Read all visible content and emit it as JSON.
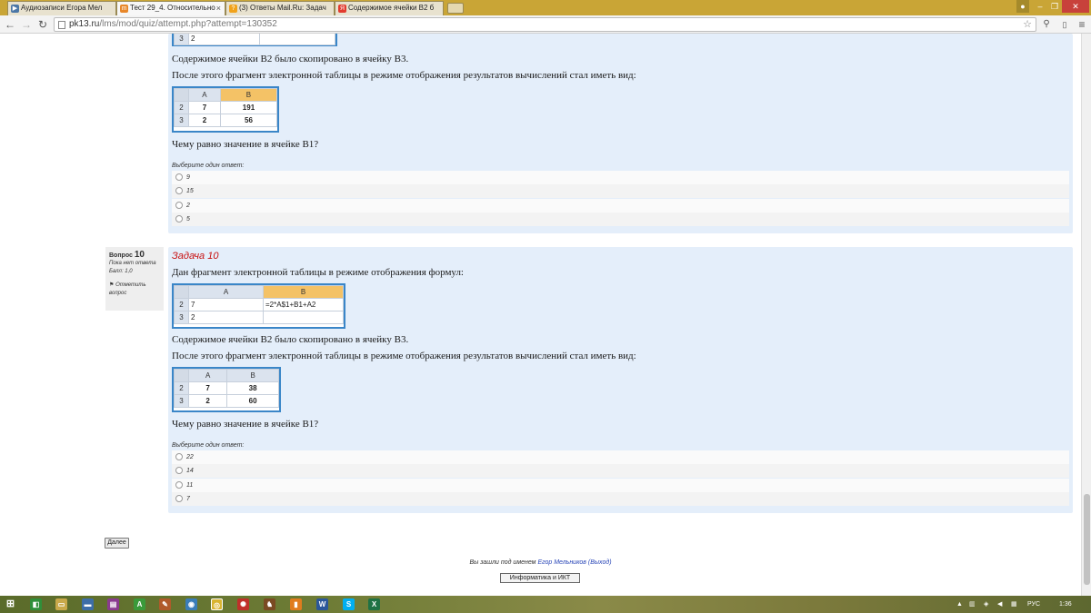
{
  "browser": {
    "tabs": [
      {
        "title": "Аудиозаписи Егора Мел",
        "icon": "vk-audio-icon",
        "color": "#4b77a7",
        "glyph": "▶"
      },
      {
        "title": "Тест 29_4. Относительно",
        "icon": "moodle-icon",
        "color": "#e8872a",
        "glyph": "m"
      },
      {
        "title": "(3) Ответы Mail.Ru: Задач",
        "icon": "mailru-answers-icon",
        "color": "#f1a21a",
        "glyph": "?"
      },
      {
        "title": "Содержимое ячейки B2 б",
        "icon": "yandex-icon",
        "color": "#e23b2e",
        "glyph": "Я"
      }
    ],
    "url_host": "pk13.ru",
    "url_path": "/lms/mod/quiz/attempt.php?attempt=130352"
  },
  "question9": {
    "table1_partial": {
      "row3": {
        "rn": "3",
        "a": "2",
        "b": ""
      }
    },
    "copy_text": "Содержимое ячейки B2 было скопировано в ячейку B3.",
    "after_text": "После этого фрагмент электронной таблицы в режиме отображения результатов вычислений стал иметь вид:",
    "table2": {
      "headers": [
        "A",
        "B"
      ],
      "rows": [
        {
          "rn": "2",
          "a": "7",
          "b": "191"
        },
        {
          "rn": "3",
          "a": "2",
          "b": "56"
        }
      ]
    },
    "question": "Чему равно значение в ячейке B1?",
    "prompt": "Выберите один ответ:",
    "options": [
      "9",
      "15",
      "2",
      "5"
    ]
  },
  "question10": {
    "info": {
      "label": "Вопрос",
      "number": "10",
      "status": "Пока нет ответа",
      "score": "Балл: 1,0",
      "flag": "Отметить вопрос"
    },
    "title": "Задача 10",
    "intro": "Дан фрагмент электронной таблицы в режиме отображения формул:",
    "table1": {
      "headers": [
        "A",
        "B"
      ],
      "rows": [
        {
          "rn": "2",
          "a": "7",
          "b": "=2*A$1+B1+A2"
        },
        {
          "rn": "3",
          "a": "2",
          "b": ""
        }
      ]
    },
    "copy_text": "Содержимое ячейки B2 было скопировано в ячейку B3.",
    "after_text": "После этого фрагмент электронной таблицы в режиме отображения результатов вычислений стал иметь вид:",
    "table2": {
      "headers": [
        "A",
        "B"
      ],
      "rows": [
        {
          "rn": "2",
          "a": "7",
          "b": "38"
        },
        {
          "rn": "3",
          "a": "2",
          "b": "60"
        }
      ]
    },
    "question": "Чему равно значение в ячейке B1?",
    "prompt": "Выберите один ответ:",
    "options": [
      "22",
      "14",
      "11",
      "7"
    ]
  },
  "footer": {
    "next_label": "Далее",
    "logged_in_prefix": "Вы зашли под именем",
    "user_name": "Егор Мельников",
    "logout": "(Выход)",
    "course_button": "Информатика и ИКТ"
  },
  "taskbar": {
    "language": "РУС",
    "time": "1:36"
  }
}
